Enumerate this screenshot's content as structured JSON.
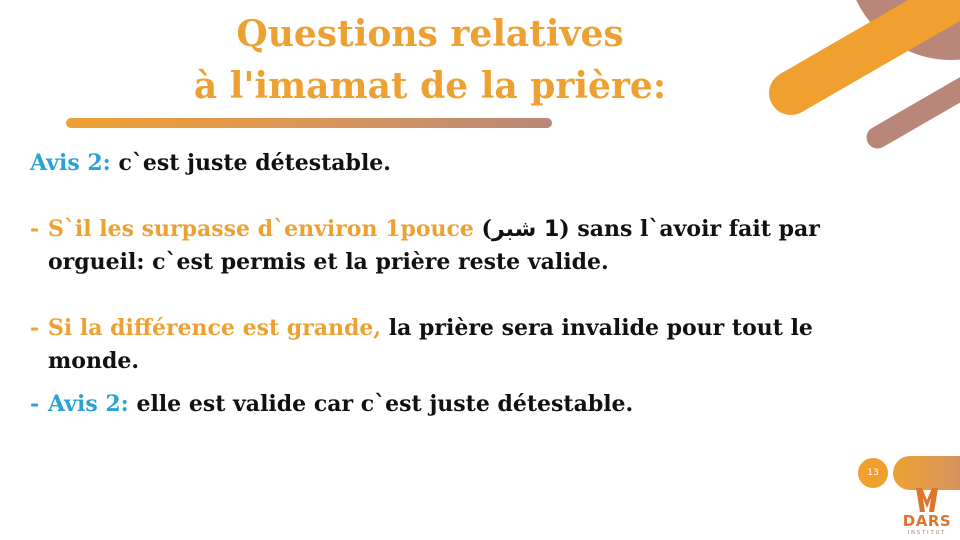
{
  "slide": {
    "title_line1": "Questions relatives",
    "title_line2": "à l'imamat de la prière:",
    "intro": {
      "label": "Avis 2:",
      "text": " c`est juste détestable."
    },
    "bullets": [
      {
        "dash": "-",
        "highlight": "S`il les surpasse d`environ 1pouce",
        "paren_open": " (",
        "arabic": "1 شبر",
        "paren_close": ")",
        "text_rest": " sans l`avoir fait par",
        "continuation": "orgueil: c`est permis et la prière reste valide."
      },
      {
        "dash": "-",
        "highlight": "Si la différence est grande,",
        "text_rest": " la prière sera invalide pour tout le",
        "continuation": "monde."
      },
      {
        "dash": "-",
        "highlight": "Avis 2:",
        "text_rest": " elle est valide car c`est juste détestable."
      }
    ],
    "page_number": "13"
  },
  "brand": {
    "logo_text": "DARS",
    "logo_subtext": "INSTITUT",
    "colors": {
      "orange": "#EDA132",
      "blue": "#2AA3D4",
      "mauve": "#B8877A",
      "text": "#111111"
    }
  }
}
